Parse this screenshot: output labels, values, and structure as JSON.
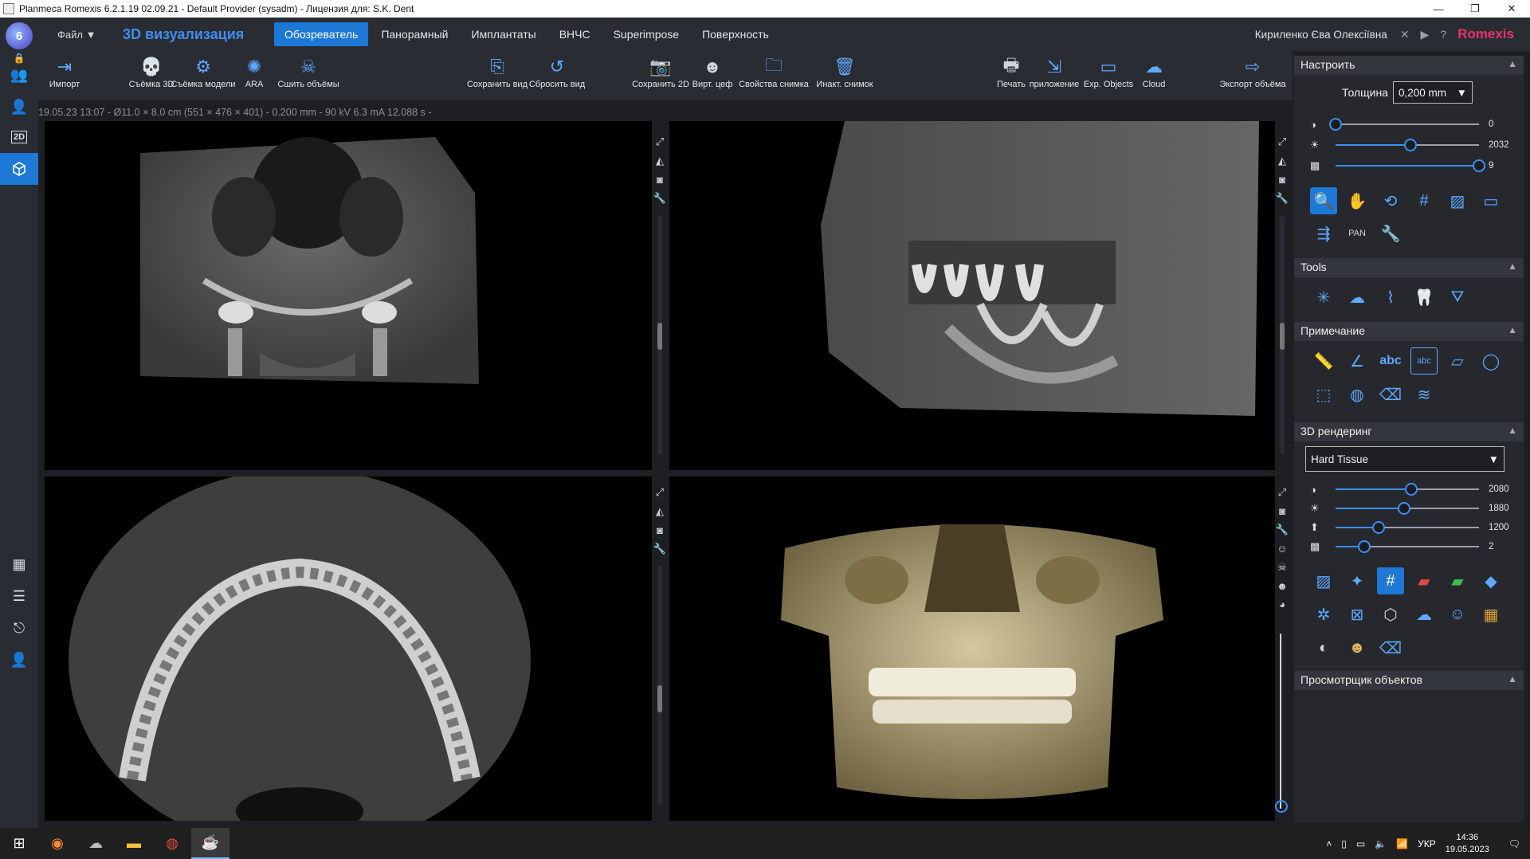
{
  "window": {
    "title": "Planmeca Romexis 6.2.1.19 02.09.21 - Default Provider (sysadm) - Лицензия для: S.K. Dent",
    "minimize": "—",
    "maximize": "❐",
    "close": "✕"
  },
  "menubar": {
    "file": "Файл",
    "app_title": "3D визуализация",
    "tabs": [
      "Обозреватель",
      "Панорамный",
      "Имплантаты",
      "ВНЧС",
      "Superimpose",
      "Поверхность"
    ],
    "active_tab": "Обозреватель",
    "user": "Кириленко Єва Олексіївна",
    "brand": "Romexis"
  },
  "leftnav": {
    "logo": "6",
    "label_2d": "2D"
  },
  "toolbar": {
    "items": [
      {
        "label": "Импорт",
        "icon": "import-icon"
      },
      {
        "label": "Съёмка 3D",
        "icon": "capture-3d-icon"
      },
      {
        "label": "Съёмка модели",
        "icon": "capture-model-icon"
      },
      {
        "label": "ARA",
        "icon": "ara-icon"
      },
      {
        "label": "Сшить объёмы",
        "icon": "stitch-volumes-icon"
      },
      {
        "label": "Сохранить вид",
        "icon": "save-view-icon"
      },
      {
        "label": "Сбросить вид",
        "icon": "reset-view-icon"
      },
      {
        "label": "Сохранить 2D",
        "icon": "save-2d-icon"
      },
      {
        "label": "Вирт. цеф",
        "icon": "virtual-ceph-icon"
      },
      {
        "label": "Свойства снимка",
        "icon": "image-properties-icon"
      },
      {
        "label": "Инакт. снимок",
        "icon": "inactivate-image-icon"
      },
      {
        "label": "Печать",
        "icon": "print-icon"
      },
      {
        "label": "приложение",
        "icon": "application-icon"
      },
      {
        "label": "Exp. Objects",
        "icon": "export-objects-icon"
      },
      {
        "label": "Cloud",
        "icon": "cloud-icon"
      },
      {
        "label": "Экспорт объёма",
        "icon": "export-volume-icon"
      }
    ]
  },
  "infostrip": "19.05.23 13:07 - Ø11.0 × 8.0 cm (551 × 476 × 401) - 0.200 mm - 90 kV 6.3 mA 12.088 s -",
  "panel": {
    "adjust": {
      "title": "Настроить",
      "thickness_label": "Толщина",
      "thickness_value": "0,200 mm",
      "sliders": [
        {
          "icon": "contrast-icon",
          "value": "0",
          "level": 0.0
        },
        {
          "icon": "brightness-icon",
          "value": "2032",
          "level": 0.52
        },
        {
          "icon": "sharpness-icon",
          "value": "9",
          "level": 1.0
        }
      ]
    },
    "tools": {
      "title": "Tools"
    },
    "notes": {
      "title": "Примечание",
      "abc1": "abc",
      "abc2": "abc"
    },
    "rendering": {
      "title": "3D рендеринг",
      "preset": "Hard Tissue",
      "sliders": [
        {
          "icon": "contrast-icon",
          "value": "2080",
          "level": 0.53
        },
        {
          "icon": "brightness-icon",
          "value": "1880",
          "level": 0.48
        },
        {
          "icon": "arrow-up-icon",
          "value": "1200",
          "level": 0.3
        },
        {
          "icon": "sharpness-icon",
          "value": "2",
          "level": 0.2
        }
      ]
    },
    "object_viewer": {
      "title": "Просмотрщик объектов"
    }
  },
  "taskbar": {
    "lang": "УКР",
    "time": "14:36",
    "date": "19.05.2023"
  },
  "colors": {
    "accent": "#1d78d6",
    "icon_blue": "#5da9ff",
    "brand": "#e8336a",
    "background": "#1e1f23"
  }
}
